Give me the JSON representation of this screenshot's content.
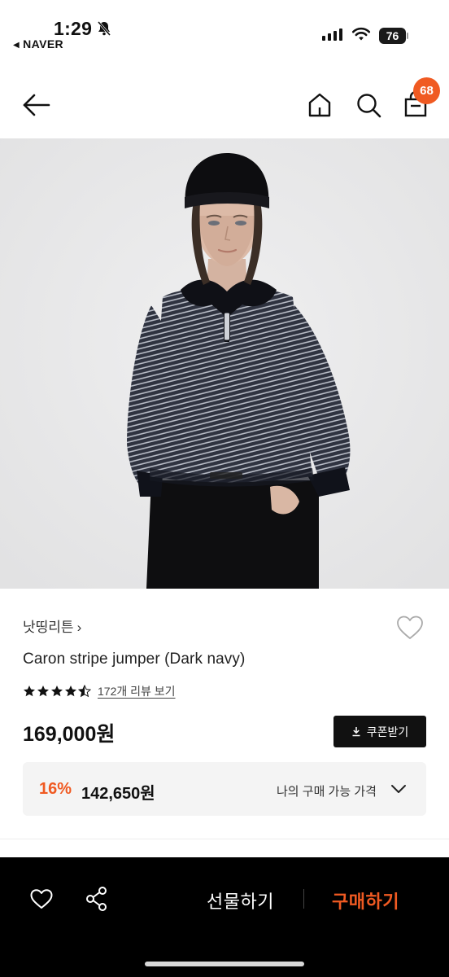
{
  "status_bar": {
    "time": "1:29",
    "back_app": "NAVER",
    "battery": "76"
  },
  "header": {
    "cart_count": "68"
  },
  "product": {
    "brand": "낫띵리튼",
    "name": "Caron stripe jumper (Dark navy)",
    "rating": 4.5,
    "review_link": "172개 리뷰 보기",
    "price": "169,000원",
    "coupon_label": "쿠폰받기",
    "discount_rate": "16%",
    "discount_price": "142,650원",
    "my_price_label": "나의 구매 가능 가격"
  },
  "bottom_bar": {
    "gift_label": "선물하기",
    "buy_label": "구매하기"
  },
  "colors": {
    "accent": "#f05a22",
    "bottom_bar_bg": "#000000",
    "image_bg": "#e9e9ea"
  }
}
